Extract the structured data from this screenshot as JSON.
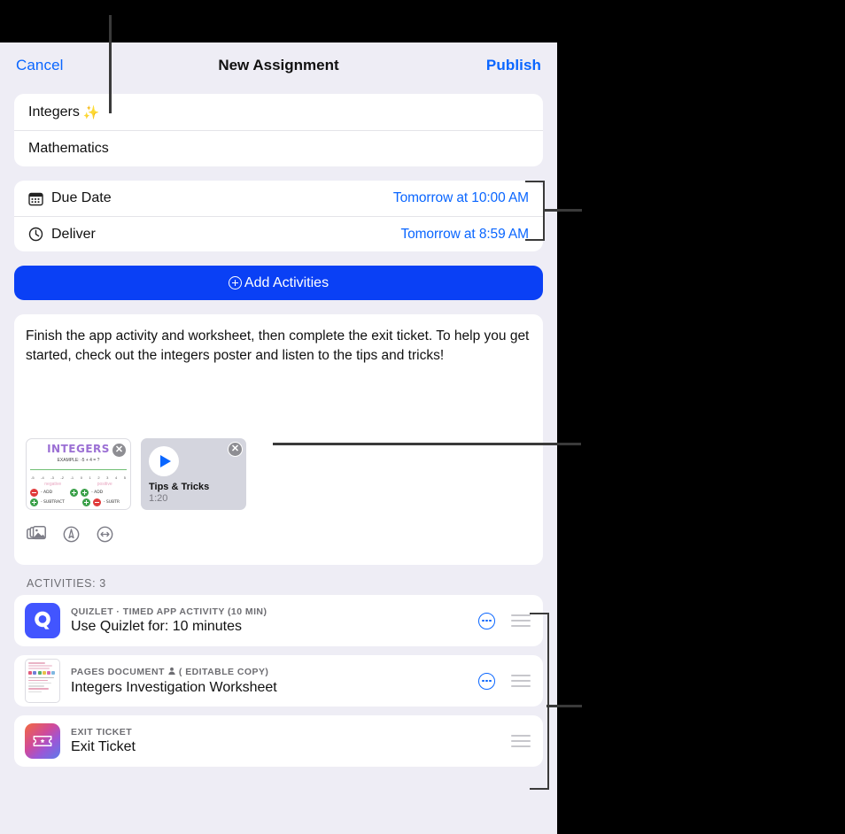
{
  "navbar": {
    "cancel_label": "Cancel",
    "title": "New Assignment",
    "publish_label": "Publish"
  },
  "fields": {
    "title_value": "Integers",
    "title_emoji": "✨",
    "subject_value": "Mathematics"
  },
  "schedule": [
    {
      "icon": "calendar-icon",
      "label": "Due Date",
      "value": "Tomorrow at 10:00 AM"
    },
    {
      "icon": "clock-icon",
      "label": "Deliver",
      "value": "Tomorrow at 8:59 AM"
    }
  ],
  "add_activities": {
    "label": "Add Activities",
    "icon": "plus-circle-icon",
    "accent": "#0A40F5"
  },
  "note": {
    "text": "Finish the app activity and worksheet, then complete the exit ticket. To help you get started, check out the integers poster and listen to the tips and tricks!",
    "attachments": [
      {
        "type": "image",
        "name": "integers-poster",
        "poster_title": "INTEGERS",
        "poster_example": "EXAMPLE:  -5 + 4 = ?",
        "poster_numbers": [
          "-5",
          "-4",
          "-3",
          "-2",
          "-1",
          "0",
          "1",
          "2",
          "3",
          "4",
          "5"
        ],
        "poster_col_left": "negative",
        "poster_col_right": "positive",
        "poster_rules": [
          {
            "left_sign": "neg",
            "right_sign": "neg",
            "op": "ADD"
          },
          {
            "left_sign": "pos",
            "right_sign": "neg",
            "op": "SUBTRACT"
          }
        ],
        "poster_rules_right": [
          {
            "left_sign": "pos",
            "right_sign": "pos",
            "op": "ADD"
          },
          {
            "left_sign": "pos",
            "right_sign": "neg",
            "op": "SUBTRACT"
          }
        ],
        "remove_label": "✕"
      },
      {
        "type": "video",
        "name": "tips-and-tricks-video",
        "title": "Tips & Tricks",
        "duration": "1:20",
        "remove_label": "✕"
      }
    ],
    "tools": [
      {
        "icon": "photos-icon"
      },
      {
        "icon": "markup-pen-icon"
      },
      {
        "icon": "scribble-icon"
      }
    ]
  },
  "activities_section": {
    "header": "ACTIVITIES: 3",
    "items": [
      {
        "icon": "quizlet-app-icon",
        "kicker": "QUIZLET · TIMED APP ACTIVITY (10 MIN)",
        "name": "Use Quizlet for: 10 minutes",
        "has_more": true,
        "more_icon": "more-circle-icon",
        "drag_icon": "drag-handle-icon"
      },
      {
        "icon": "pages-document-icon",
        "kicker_main": "PAGES DOCUMENT",
        "kicker_badge_icon": "person-icon",
        "kicker_badge": "( EDITABLE COPY)",
        "kicker": "PAGES DOCUMENT  ( EDITABLE COPY)",
        "name": "Integers Investigation Worksheet",
        "has_more": true,
        "more_icon": "more-circle-icon",
        "drag_icon": "drag-handle-icon"
      },
      {
        "icon": "exit-ticket-icon",
        "kicker": "EXIT TICKET",
        "name": "Exit Ticket",
        "has_more": false,
        "drag_icon": "drag-handle-icon"
      }
    ]
  },
  "colors": {
    "accent_blue": "#0a66ff",
    "button_blue": "#0A40F5",
    "panel_bg": "#EEEDF5",
    "card_bg": "#FFFFFF",
    "callout": "#3A3A3A",
    "quizlet": "#4255FF"
  }
}
